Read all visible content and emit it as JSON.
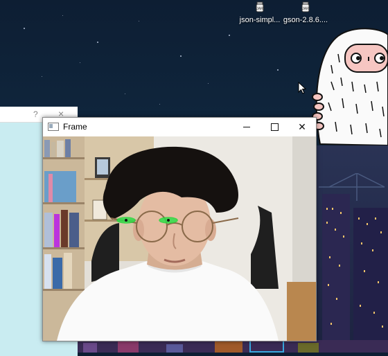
{
  "desktop": {
    "icons": [
      {
        "label": "json-simpl...",
        "icon": "jar-file-icon"
      },
      {
        "label": "gson-2.8.6....",
        "icon": "jar-file-icon"
      }
    ]
  },
  "background_window": {
    "help_glyph": "?",
    "close_glyph": "×"
  },
  "frame_window": {
    "title": "Frame",
    "close_glyph": "✕"
  },
  "colors": {
    "desktop_bg": "#0d1e33",
    "bg_window": "#c9ecf1",
    "eye_tracking": "#27d63b"
  }
}
